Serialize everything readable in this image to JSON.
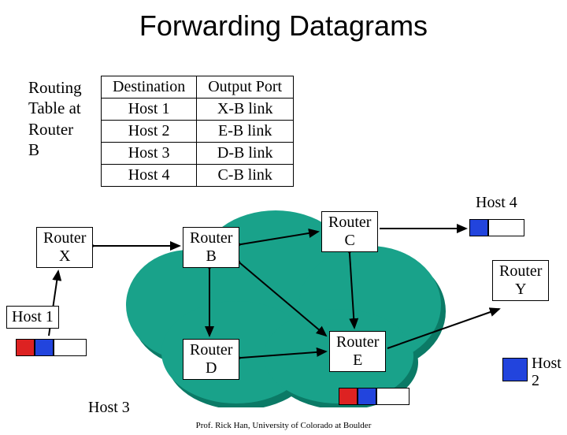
{
  "title": "Forwarding Datagrams",
  "routing_label": {
    "l1": "Routing",
    "l2": "Table at",
    "l3": "Router",
    "l4": "B"
  },
  "table": {
    "header": {
      "dest": "Destination",
      "port": "Output Port"
    },
    "rows": [
      {
        "dest": "Host 1",
        "port": "X-B link"
      },
      {
        "dest": "Host 2",
        "port": "E-B link"
      },
      {
        "dest": "Host 3",
        "port": "D-B link"
      },
      {
        "dest": "Host 4",
        "port": "C-B link"
      }
    ]
  },
  "nodes": {
    "router_x": {
      "l1": "Router",
      "l2": "X"
    },
    "router_b": {
      "l1": "Router",
      "l2": "B"
    },
    "router_c": {
      "l1": "Router",
      "l2": "C"
    },
    "router_d": {
      "l1": "Router",
      "l2": "D"
    },
    "router_e": {
      "l1": "Router",
      "l2": "E"
    },
    "router_y": {
      "l1": "Router",
      "l2": "Y"
    }
  },
  "hosts": {
    "h1": "Host 1",
    "h2_l1": "Host",
    "h2_l2": "2",
    "h3": "Host 3",
    "h4": "Host 4"
  },
  "colors": {
    "cloud_fill": "#19a28a",
    "cloud_shadow": "#0b7a66"
  },
  "credit": "Prof. Rick Han, University of Colorado at Boulder"
}
